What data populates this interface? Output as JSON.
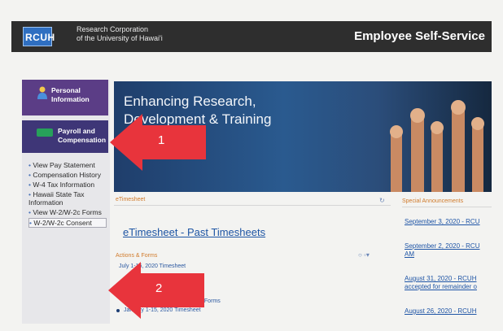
{
  "header": {
    "logo_text": "RCUH",
    "org_line1": "Research Corporation",
    "org_line2": "of the University of Hawai'i",
    "portal_title": "Employee Self-Service"
  },
  "sidebar": {
    "personal": {
      "line1": "Personal",
      "line2": "Information"
    },
    "payroll": {
      "line1": "Payroll and",
      "line2": "Compensation"
    },
    "links": [
      {
        "label": "View Pay Statement"
      },
      {
        "label": "Compensation History"
      },
      {
        "label": "W-4 Tax Information"
      },
      {
        "label": "Hawaii State Tax Information"
      },
      {
        "label": "View W-2/W-2c Forms"
      },
      {
        "label": "W-2/W-2c Consent"
      }
    ]
  },
  "hero": {
    "line1": "Enhancing Research,",
    "line2": "Development & Training"
  },
  "main": {
    "etimesheet_header": "eTimesheet",
    "past_timesheets_link": "eTimesheet - Past Timesheets",
    "actions_header": "Actions & Forms",
    "items": [
      "July 1-15, 2020 Timesheet",
      "Certification Forms",
      "January 1-15, 2020 Timesheet"
    ]
  },
  "announcements": {
    "header": "Special Announcements",
    "items": [
      "September 3, 2020 - RCU",
      "September 2, 2020 - RCU",
      "AM",
      "August 31, 2020 - RCUH",
      "accepted for remainder o",
      "August 26, 2020 - RCUH"
    ]
  },
  "annotations": {
    "arrow1_label": "1",
    "arrow2_label": "2",
    "color": "#e8343c"
  }
}
